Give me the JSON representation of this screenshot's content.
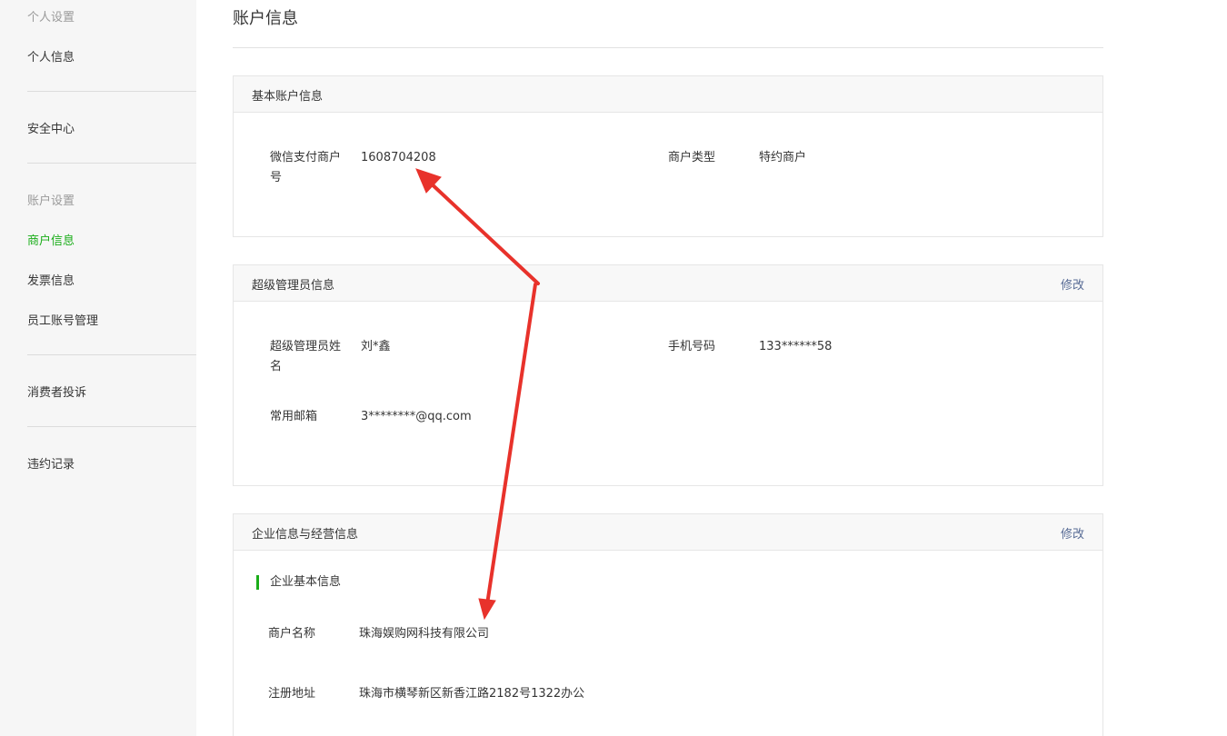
{
  "sidebar": {
    "group_personal": "个人设置",
    "personal_info": "个人信息",
    "security_center": "安全中心",
    "group_account": "账户设置",
    "merchant_info": "商户信息",
    "invoice_info": "发票信息",
    "staff_accounts": "员工账号管理",
    "consumer_complaints": "消费者投诉",
    "violation_records": "违约记录"
  },
  "page": {
    "title": "账户信息"
  },
  "basic": {
    "title": "基本账户信息",
    "merchant_id_label": "微信支付商户号",
    "merchant_id_value": "1608704208",
    "merchant_type_label": "商户类型",
    "merchant_type_value": "特约商户"
  },
  "admin": {
    "title": "超级管理员信息",
    "edit": "修改",
    "name_label": "超级管理员姓名",
    "name_value": "刘*鑫",
    "phone_label": "手机号码",
    "phone_value": "133******58",
    "email_label": "常用邮箱",
    "email_value": "3********@qq.com"
  },
  "enterprise": {
    "title": "企业信息与经营信息",
    "edit": "修改",
    "sub_title": "企业基本信息",
    "name_label": "商户名称",
    "name_value": "珠海娱购网科技有限公司",
    "address_label": "注册地址",
    "address_value": "珠海市横琴新区新香江路2182号1322办公"
  },
  "colors": {
    "accent_green": "#1aad19",
    "link_blue": "#576b95",
    "annotation_red": "#e8322b"
  }
}
